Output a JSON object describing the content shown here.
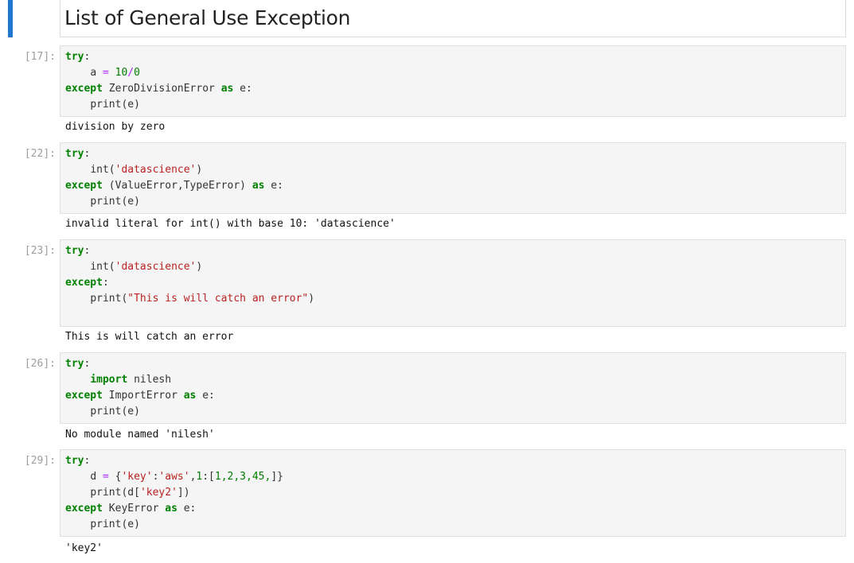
{
  "notebook": {
    "heading": "List of General Use Exception",
    "cells": [
      {
        "prompt": "[17]:",
        "output": "division by zero"
      },
      {
        "prompt": "[22]:",
        "output": "invalid literal for int() with base 10: 'datascience'"
      },
      {
        "prompt": "[23]:",
        "output": "This is will catch an error"
      },
      {
        "prompt": "[26]:",
        "output": "No module named 'nilesh'"
      },
      {
        "prompt": "[29]:",
        "output": "'key2'"
      }
    ],
    "code": {
      "kw_try": "try",
      "kw_except": "except",
      "kw_as": "as",
      "kw_import": "import",
      "colon": ":",
      "c17_l2_a": "a",
      "c17_l2_eq": "=",
      "c17_l2_n1": "10",
      "c17_l2_div": "/",
      "c17_l2_n2": "0",
      "c17_l3_err": "ZeroDivisionError",
      "c17_l3_e": "e:",
      "print_e": "print(e)",
      "c22_int_open": "int(",
      "str_datascience": "'datascience'",
      "close_paren": ")",
      "c22_l3_err": "(ValueError,TypeError)",
      "c23_print_open": "print(",
      "c23_str": "\"This is will catch an error\"",
      "c26_module": "nilesh",
      "c26_err": "ImportError",
      "c29_d": "d",
      "c29_brace_open": "{",
      "c29_key": "'key'",
      "c29_colon": ":",
      "c29_aws": "'aws'",
      "c29_comma1": ",",
      "c29_1": "1",
      "c29_bracket_open": "[",
      "c29_list": "1,2,3,45,",
      "c29_bracket_close": "]}",
      "c29_print_open": "print(d[",
      "c29_key2": "'key2'",
      "c29_print_close": "])",
      "c29_err": "KeyError"
    }
  }
}
